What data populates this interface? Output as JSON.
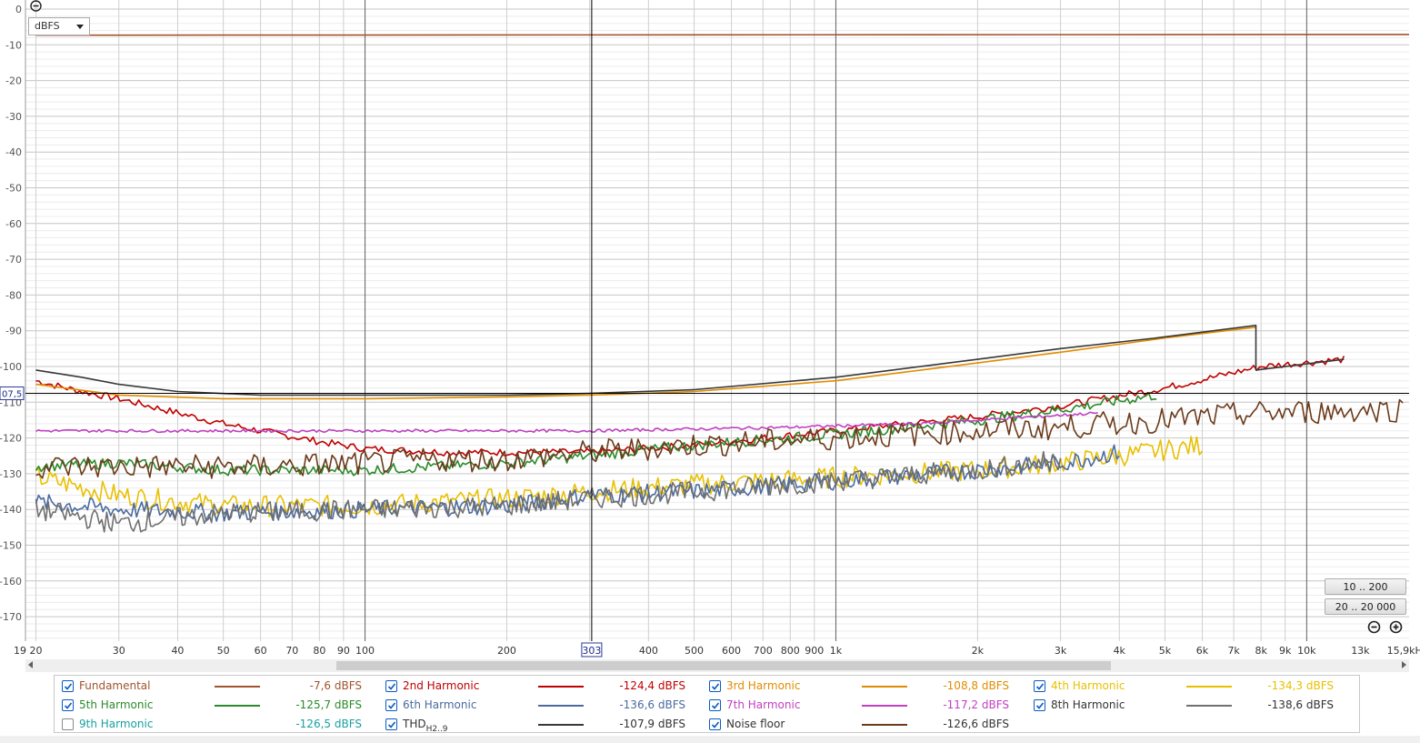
{
  "toolbar": {
    "unit": "dBFS"
  },
  "ranges": {
    "btn1": "10 .. 200",
    "btn2": "20 .. 20 000"
  },
  "cursor": {
    "freq_label": "303",
    "level_label": "07,5",
    "freq": 303,
    "level": -107.5
  },
  "chart_data": {
    "type": "line",
    "xscale": "log",
    "xlim": [
      19,
      16500
    ],
    "ylim": [
      -180,
      0
    ],
    "yticks": [
      0,
      -10,
      -20,
      -30,
      -40,
      -50,
      -60,
      -70,
      -80,
      -90,
      -100,
      -110,
      -120,
      -130,
      -140,
      -150,
      -160,
      -170
    ],
    "ytick_labels": [
      "0",
      "-10",
      "-20",
      "-30",
      "-40",
      "-50",
      "-60",
      "-70",
      "-80",
      "-90",
      "-100",
      "-110",
      "-120",
      "-130",
      "-140",
      "-150",
      "-160",
      "-170"
    ],
    "xtick_labels": [
      {
        "x": 19,
        "label": "19"
      },
      {
        "x": 20,
        "label": "20"
      },
      {
        "x": 30,
        "label": "30"
      },
      {
        "x": 40,
        "label": "40"
      },
      {
        "x": 50,
        "label": "50"
      },
      {
        "x": 60,
        "label": "60"
      },
      {
        "x": 70,
        "label": "70"
      },
      {
        "x": 80,
        "label": "80"
      },
      {
        "x": 90,
        "label": "90"
      },
      {
        "x": 100,
        "label": "100"
      },
      {
        "x": 200,
        "label": "200"
      },
      {
        "x": 400,
        "label": "400"
      },
      {
        "x": 500,
        "label": "500"
      },
      {
        "x": 600,
        "label": "600"
      },
      {
        "x": 700,
        "label": "700"
      },
      {
        "x": 800,
        "label": "800"
      },
      {
        "x": 900,
        "label": "900"
      },
      {
        "x": 1000,
        "label": "1k"
      },
      {
        "x": 2000,
        "label": "2k"
      },
      {
        "x": 3000,
        "label": "3k"
      },
      {
        "x": 4000,
        "label": "4k"
      },
      {
        "x": 5000,
        "label": "5k"
      },
      {
        "x": 6000,
        "label": "6k"
      },
      {
        "x": 7000,
        "label": "7k"
      },
      {
        "x": 8000,
        "label": "8k"
      },
      {
        "x": 9000,
        "label": "9k"
      },
      {
        "x": 10000,
        "label": "10k"
      },
      {
        "x": 13000,
        "label": "13k"
      },
      {
        "x": 15900,
        "label": "15,9kHz"
      }
    ],
    "series": [
      {
        "name": "Fundamental",
        "color": "#a0522d",
        "checked": true,
        "value": "-7,6 dBFS",
        "noise": 0,
        "x": [
          20,
          16500
        ],
        "y": [
          -7.3,
          -7.1
        ]
      },
      {
        "name": "2nd Harmonic",
        "color": "#c00000",
        "checked": true,
        "value": "-124,4 dBFS",
        "noise": 1,
        "x": [
          20,
          25,
          30,
          40,
          50,
          60,
          80,
          100,
          150,
          200,
          300,
          500,
          700,
          1000,
          2000,
          3000,
          5000,
          8000,
          12000
        ],
        "y": [
          -104,
          -107,
          -109,
          -113,
          -116,
          -118,
          -121,
          -123,
          -124,
          -124,
          -124,
          -122,
          -120,
          -118,
          -114,
          -111,
          -106,
          -100,
          -98
        ]
      },
      {
        "name": "3rd Harmonic",
        "color": "#e08c00",
        "checked": true,
        "value": "-108,8 dBFS",
        "noise": 0,
        "x": [
          20,
          30,
          50,
          100,
          200,
          300,
          500,
          1000,
          2000,
          3000,
          5000,
          7800
        ],
        "y": [
          -105,
          -108,
          -109,
          -109,
          -108.5,
          -108,
          -107,
          -104,
          -99,
          -96,
          -92,
          -89
        ]
      },
      {
        "name": "4th Harmonic",
        "color": "#e8c000",
        "checked": true,
        "value": "-134,3 dBFS",
        "noise": 3,
        "x": [
          20,
          30,
          50,
          100,
          200,
          300,
          500,
          1000,
          2000,
          3000,
          4000,
          6000
        ],
        "y": [
          -131,
          -136,
          -139,
          -139,
          -137,
          -135,
          -133,
          -131,
          -129,
          -127,
          -125,
          -122
        ]
      },
      {
        "name": "5th Harmonic",
        "color": "#2a8a2a",
        "checked": true,
        "value": "-125,7 dBFS",
        "noise": 1.5,
        "x": [
          20,
          30,
          50,
          100,
          200,
          300,
          500,
          1000,
          2000,
          3000,
          4800
        ],
        "y": [
          -128,
          -127,
          -129,
          -129,
          -127,
          -125,
          -122,
          -119,
          -115,
          -112,
          -108
        ]
      },
      {
        "name": "6th Harmonic",
        "color": "#4a6aa0",
        "checked": true,
        "value": "-136,6 dBFS",
        "noise": 2.5,
        "x": [
          20,
          30,
          50,
          100,
          200,
          300,
          500,
          1000,
          2000,
          3000,
          4000
        ],
        "y": [
          -138,
          -140,
          -141,
          -140,
          -139,
          -136,
          -135,
          -132,
          -129,
          -127,
          -124
        ]
      },
      {
        "name": "7th Harmonic",
        "color": "#c040c0",
        "checked": true,
        "value": "-117,2 dBFS",
        "noise": 0.4,
        "x": [
          20,
          50,
          100,
          300,
          800,
          1500,
          3600
        ],
        "y": [
          -118,
          -118,
          -118,
          -118,
          -117,
          -116,
          -113
        ]
      },
      {
        "name": "8th Harmonic",
        "color": "#707070",
        "checked": true,
        "value": "-138,6 dBFS",
        "noise": 3,
        "x": [
          20,
          30,
          50,
          100,
          200,
          300,
          500,
          1000,
          2000,
          3000
        ],
        "y": [
          -140,
          -144,
          -141,
          -140,
          -139,
          -137,
          -135,
          -132,
          -129,
          -126
        ]
      },
      {
        "name": "9th Harmonic",
        "color": "#1aa0a0",
        "checked": false,
        "value": "-126,5 dBFS",
        "noise": 0,
        "x": [],
        "y": []
      },
      {
        "name": "THD",
        "sub": "H2..9",
        "color": "#383838",
        "checked": true,
        "value": "-107,9 dBFS",
        "noise": 0,
        "x": [
          20,
          25,
          30,
          40,
          60,
          100,
          200,
          300,
          500,
          1000,
          2000,
          3000,
          4800,
          7800,
          7801,
          12000
        ],
        "y": [
          -101,
          -103,
          -105,
          -107,
          -108,
          -108,
          -108,
          -107.5,
          -106.5,
          -103,
          -98,
          -95,
          -92,
          -88.5,
          -101,
          -98
        ]
      },
      {
        "name": "Noise floor",
        "color": "#6b3a1a",
        "checked": true,
        "value": "-126,6 dBFS",
        "noise": 3.5,
        "x": [
          20,
          60,
          100,
          150,
          200,
          300,
          500,
          1000,
          2000,
          3000,
          5000,
          8000,
          16000
        ],
        "y": [
          -128,
          -128,
          -127,
          -126,
          -126,
          -124,
          -122,
          -120,
          -118,
          -117,
          -115,
          -113,
          -112
        ]
      }
    ]
  }
}
